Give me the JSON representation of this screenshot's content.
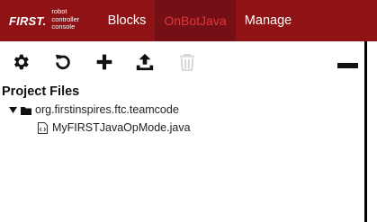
{
  "brand": {
    "name": "FIRST.",
    "tagline_lines": [
      "robot",
      "controller",
      "console"
    ]
  },
  "nav": {
    "items": [
      {
        "label": "Blocks",
        "active": false
      },
      {
        "label": "OnBotJava",
        "active": true
      },
      {
        "label": "Manage",
        "active": false
      }
    ]
  },
  "toolbar": {
    "buttons": [
      {
        "icon": "gear-icon",
        "enabled": true
      },
      {
        "icon": "undo-icon",
        "enabled": true
      },
      {
        "icon": "plus-icon",
        "enabled": true
      },
      {
        "icon": "upload-icon",
        "enabled": true
      },
      {
        "icon": "trash-icon",
        "enabled": false
      }
    ]
  },
  "project": {
    "title": "Project Files",
    "package": "org.firstinspires.ftc.teamcode",
    "files": [
      "MyFIRSTJavaOpMode.java"
    ]
  },
  "colors": {
    "header": "#8f1214",
    "active_tab_bg": "#741015",
    "active_tab_text": "#e4353a"
  }
}
